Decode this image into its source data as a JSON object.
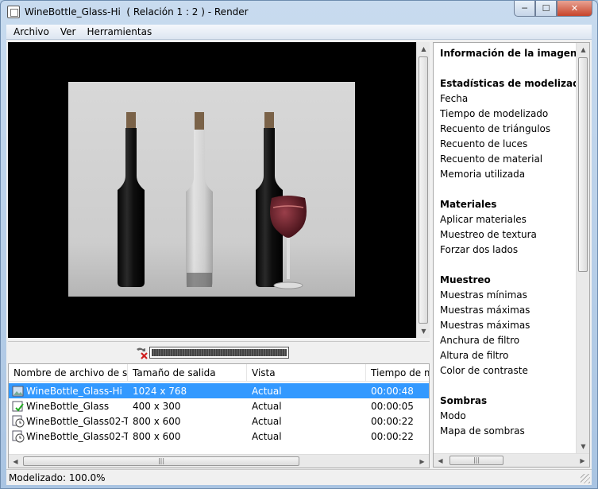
{
  "window": {
    "title": "WineBottle_Glass-Hi  ( Relación 1 : 2 ) - Render",
    "controls": {
      "minimize": "─",
      "maximize": "☐",
      "close": "✕"
    }
  },
  "menu": {
    "items": [
      "Archivo",
      "Ver",
      "Herramientas"
    ]
  },
  "render": {
    "progress_percent": 100
  },
  "file_list": {
    "columns": [
      "Nombre de archivo de s...",
      "Tamaño de salida",
      "Vista",
      "Tiempo de m"
    ],
    "rows": [
      {
        "name": "WineBottle_Glass-Hi",
        "size": "1024 x 768",
        "view": "Actual",
        "time": "00:00:48",
        "selected": true,
        "icon": "render-image-icon"
      },
      {
        "name": "WineBottle_Glass",
        "size": "400 x 300",
        "view": "Actual",
        "time": "00:00:05",
        "selected": false,
        "icon": "render-complete-icon"
      },
      {
        "name": "WineBottle_Glass02-T...",
        "size": "800 x 600",
        "view": "Actual",
        "time": "00:00:22",
        "selected": false,
        "icon": "render-pending-icon"
      },
      {
        "name": "WineBottle_Glass02-T...",
        "size": "800 x 600",
        "view": "Actual",
        "time": "00:00:22",
        "selected": false,
        "icon": "render-pending-icon"
      }
    ]
  },
  "info_panel": {
    "title": "Información de la imagen",
    "sections": [
      {
        "heading": "Estadísticas de modelizado",
        "items": [
          "Fecha",
          "Tiempo de modelizado",
          "Recuento de triángulos",
          "Recuento de luces",
          "Recuento de material",
          "Memoria utilizada"
        ]
      },
      {
        "heading": "Materiales",
        "items": [
          "Aplicar materiales",
          "Muestreo de textura",
          "Forzar dos lados"
        ]
      },
      {
        "heading": "Muestreo",
        "items": [
          "Muestras mínimas",
          "Muestras máximas",
          "Muestras máximas",
          "Anchura de filtro",
          "Altura de filtro",
          "Color de contraste"
        ]
      },
      {
        "heading": "Sombras",
        "items": [
          "Modo",
          "Mapa de sombras"
        ]
      }
    ]
  },
  "status": {
    "text": "Modelizado: 100.0%"
  },
  "icons": {
    "cancel": "cancel-render-icon",
    "app": "render-window-icon"
  },
  "colors": {
    "selection": "#3399ff",
    "viewport_bg": "#000000"
  }
}
